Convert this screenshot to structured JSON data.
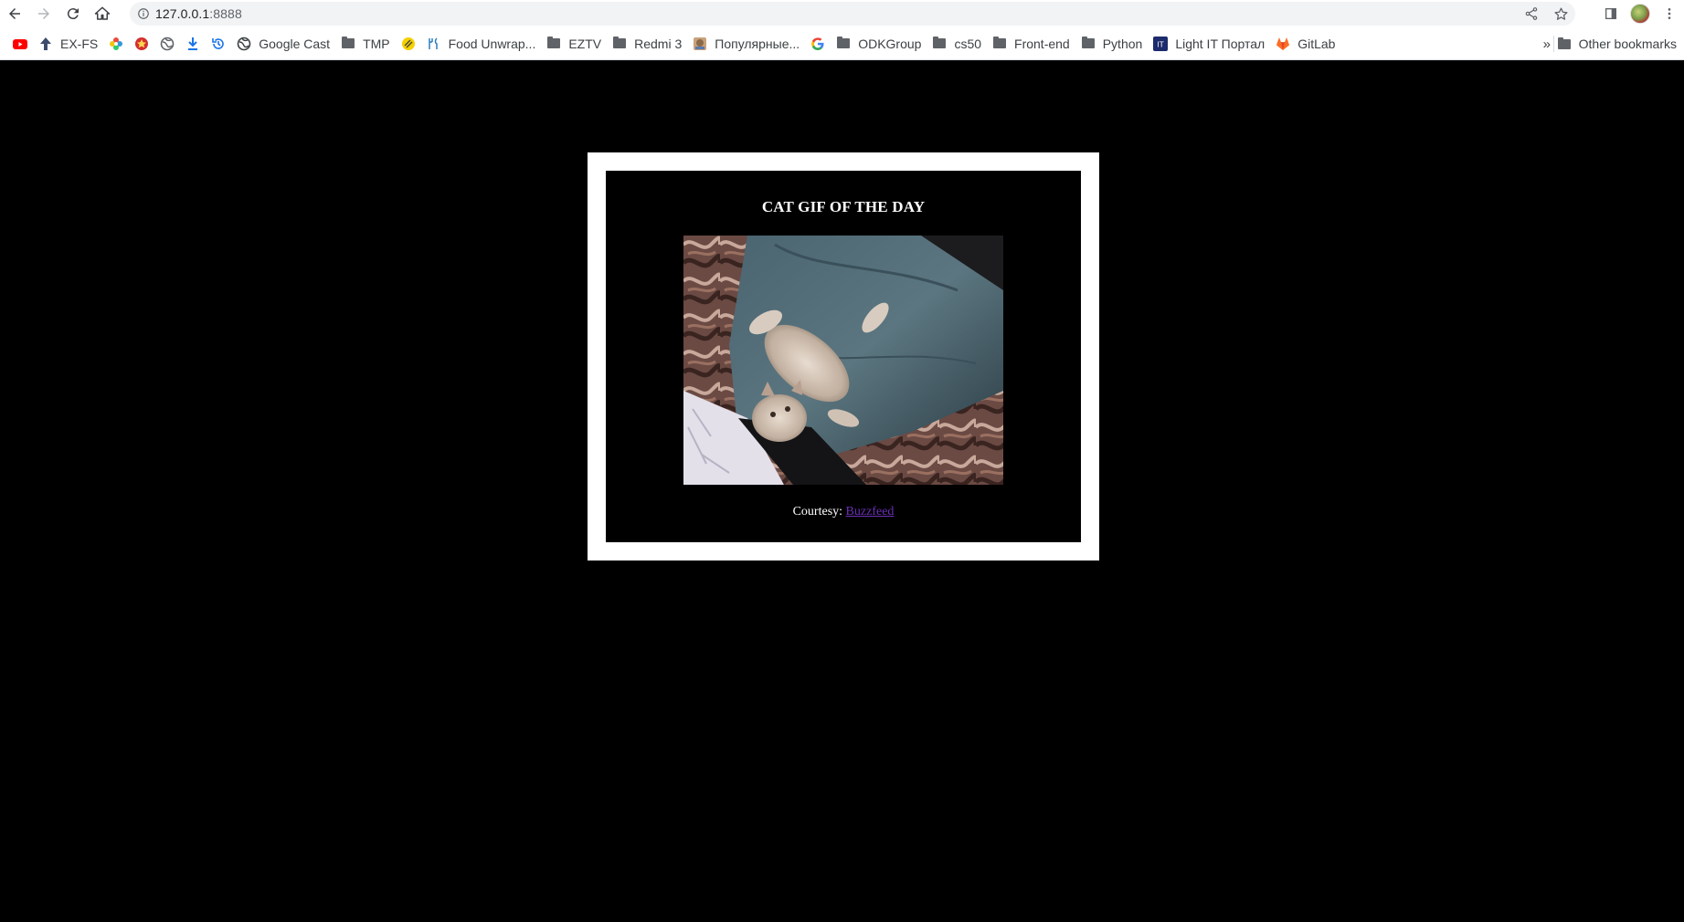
{
  "browser": {
    "url_host": "127.0.0.1",
    "url_port": ":8888",
    "icons": {
      "back": "back-arrow-icon",
      "forward": "forward-arrow-icon",
      "reload": "reload-icon",
      "home": "home-icon",
      "info": "info-icon",
      "share": "share-icon",
      "star": "star-icon",
      "sidepanel": "side-panel-icon",
      "menu": "kebab-menu-icon"
    }
  },
  "bookmarks": {
    "items": [
      {
        "label": "",
        "icon": "youtube-icon"
      },
      {
        "label": "EX-FS",
        "icon": "arrow-up-icon"
      },
      {
        "label": "",
        "icon": "flower-icon"
      },
      {
        "label": "",
        "icon": "badge-icon"
      },
      {
        "label": "",
        "icon": "globe-icon"
      },
      {
        "label": "",
        "icon": "download-icon"
      },
      {
        "label": "",
        "icon": "history-icon"
      },
      {
        "label": "Google Cast",
        "icon": "globe-icon"
      },
      {
        "label": "TMP",
        "icon": "folder-icon"
      },
      {
        "label": "",
        "icon": "yellow-circle-icon"
      },
      {
        "label": "Food Unwrap...",
        "icon": "food-icon"
      },
      {
        "label": "EZTV",
        "icon": "folder-icon"
      },
      {
        "label": "Redmi 3",
        "icon": "folder-icon"
      },
      {
        "label": "Популярные...",
        "icon": "thumbnail-icon"
      },
      {
        "label": "",
        "icon": "google-icon"
      },
      {
        "label": "ODKGroup",
        "icon": "folder-icon"
      },
      {
        "label": "cs50",
        "icon": "folder-icon"
      },
      {
        "label": "Front-end",
        "icon": "folder-icon"
      },
      {
        "label": "Python",
        "icon": "folder-icon"
      },
      {
        "label": "Light IT Портал",
        "icon": "lightit-icon"
      },
      {
        "label": "GitLab",
        "icon": "gitlab-icon"
      }
    ],
    "more": "»",
    "other": "Other bookmarks"
  },
  "content": {
    "title": "CAT GIF OF THE DAY",
    "courtesy_label": "Courtesy:",
    "courtesy_link": "Buzzfeed",
    "colors": {
      "background": "#000000",
      "frame": "#ffffff",
      "link": "#6b2fb3"
    }
  }
}
